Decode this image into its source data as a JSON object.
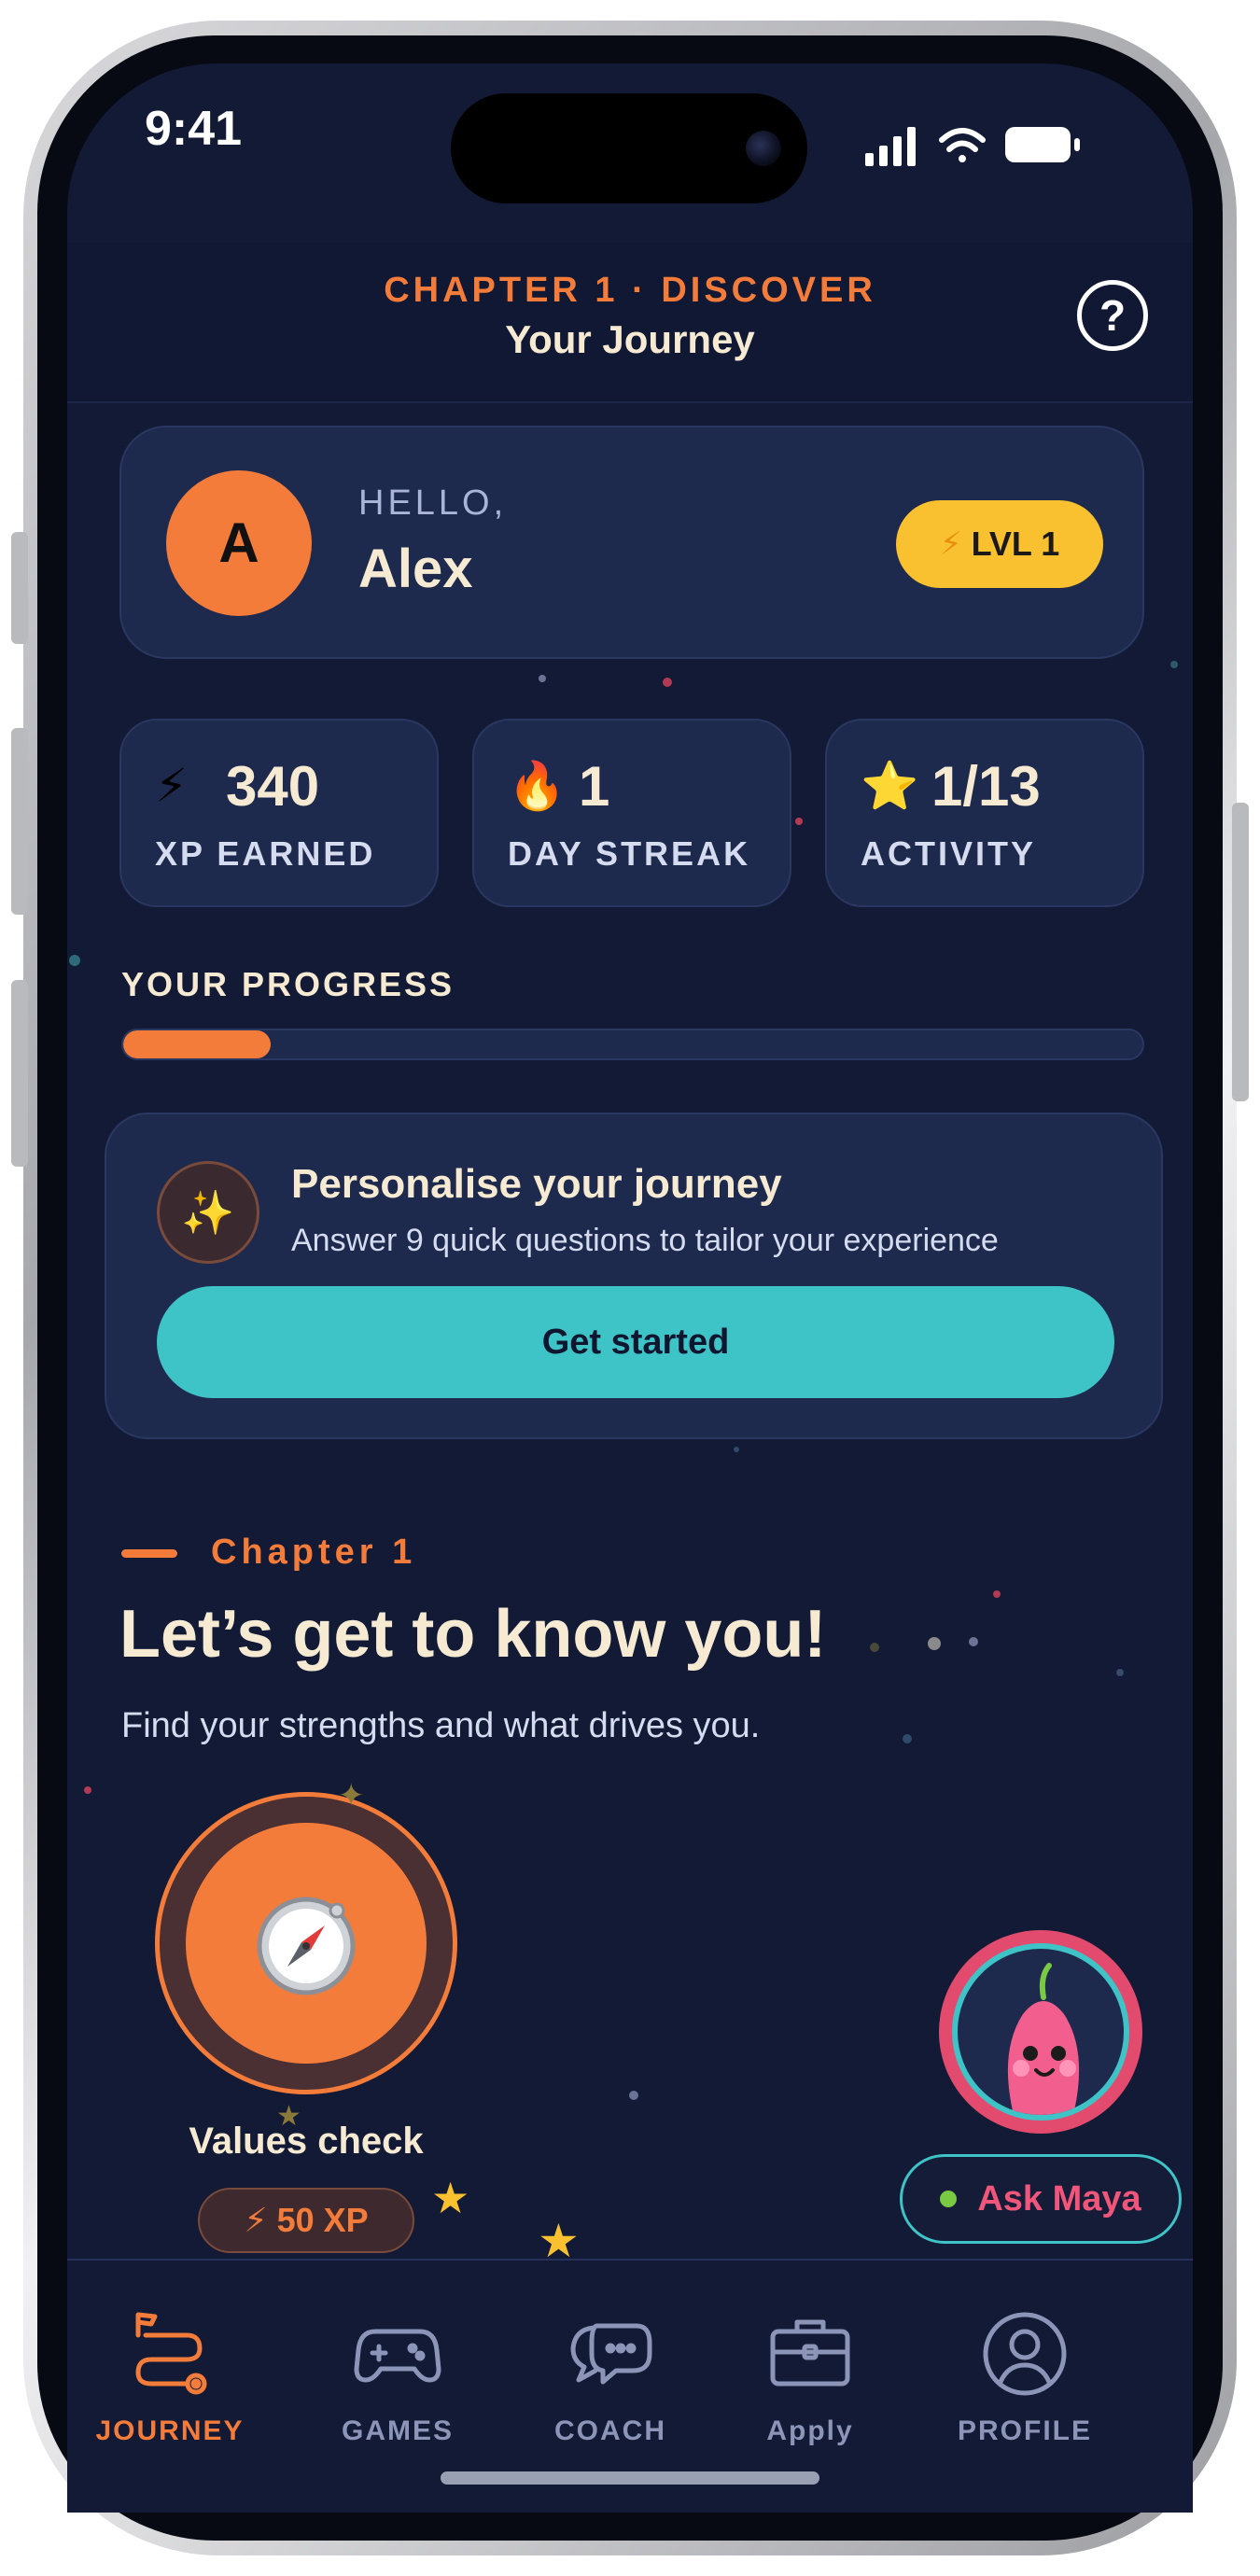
{
  "status": {
    "time": "9:41"
  },
  "header": {
    "kicker": "CHAPTER 1 · DISCOVER",
    "title": "Your Journey",
    "help_icon": "question-circle-icon",
    "help_glyph": "?"
  },
  "greeting": {
    "avatar_initial": "A",
    "hello_label": "HELLO,",
    "name": "Alex",
    "level_badge": "LVL 1",
    "level_icon": "lightning-bolt-icon"
  },
  "stats": [
    {
      "icon": "lightning-bolt-icon",
      "glyph": "⚡",
      "value": "340",
      "label": "XP EARNED"
    },
    {
      "icon": "flame-icon",
      "glyph": "🔥",
      "value": "1",
      "label": "DAY STREAK"
    },
    {
      "icon": "star-icon",
      "glyph": "⭐",
      "value": "1/13",
      "label": "ACTIVITY"
    }
  ],
  "progress": {
    "title": "YOUR PROGRESS",
    "fraction": 0.145
  },
  "personalise": {
    "icon": "sparkles-icon",
    "glyph": "✨",
    "title": "Personalise your journey",
    "subtitle": "Answer 9 quick questions to tailor your experience",
    "button": "Get started"
  },
  "chapter": {
    "label": "Chapter 1",
    "heading": "Let’s get to know you!",
    "subheading": "Find your strengths and what drives you."
  },
  "activity": {
    "icon": "compass-icon",
    "label": "Values check",
    "xp": "50 XP",
    "xp_glyph": "⚡"
  },
  "assistant": {
    "button": "Ask Maya",
    "status": "online"
  },
  "nav": [
    {
      "label": "JOURNEY",
      "icon": "journey-route-icon",
      "active": true
    },
    {
      "label": "GAMES",
      "icon": "gamepad-icon",
      "active": false
    },
    {
      "label": "COACH",
      "icon": "chat-bubbles-icon",
      "active": false
    },
    {
      "label": "Apply",
      "icon": "briefcase-icon",
      "active": false
    },
    {
      "label": "PROFILE",
      "icon": "profile-icon",
      "active": false
    }
  ],
  "colors": {
    "background": "#121a35",
    "card": "#1e2a4d",
    "accent_orange": "#f47c3a",
    "accent_teal": "#3ec3c7",
    "level_yellow": "#f9c02f",
    "text_cream": "#f6ead2",
    "maya_pink": "#f0557a"
  }
}
